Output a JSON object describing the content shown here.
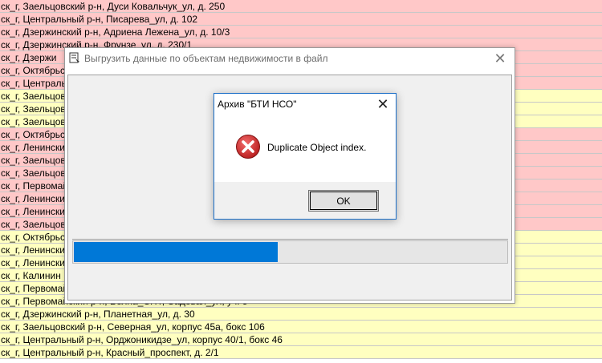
{
  "background_rows": [
    {
      "text": "ск_г, Заельцовский р-н, Дуси Ковальчук_ул, д. 250",
      "color": "pink"
    },
    {
      "text": "ск_г, Центральный р-н, Писарева_ул, д. 102",
      "color": "pink"
    },
    {
      "text": "ск_г, Дзержинский р-н, Адриена Лежена_ул, д. 10/3",
      "color": "pink"
    },
    {
      "text": "ск_г, Дзержинский р-н, Фрунзе_ул, д. 230/1",
      "color": "pink"
    },
    {
      "text": "ск_г, Дзержи",
      "color": "pink"
    },
    {
      "text": "ск_г, Октябрьс",
      "color": "pink"
    },
    {
      "text": "ск_г, Централь",
      "color": "pink"
    },
    {
      "text": "ск_г, Заельцов",
      "color": "yellow"
    },
    {
      "text": "ск_г, Заельцов",
      "color": "yellow"
    },
    {
      "text": "ск_г, Заельцов",
      "color": "yellow"
    },
    {
      "text": "ск_г, Октябрьс",
      "color": "pink"
    },
    {
      "text": "ск_г, Ленински",
      "color": "pink"
    },
    {
      "text": "ск_г, Заельцов",
      "color": "pink"
    },
    {
      "text": "ск_г, Заельцов",
      "color": "pink"
    },
    {
      "text": "ск_г, Первомай",
      "color": "pink"
    },
    {
      "text": "ск_г, Ленински",
      "color": "pink"
    },
    {
      "text": "ск_г, Ленински",
      "color": "pink"
    },
    {
      "text": "ск_г, Заельцов",
      "color": "pink"
    },
    {
      "text": "ск_г, Октябрьс",
      "color": "yellow"
    },
    {
      "text": "ск_г, Ленински",
      "color": "yellow"
    },
    {
      "text": "ск_г, Ленински",
      "color": "yellow"
    },
    {
      "text": "ск_г, Калинин",
      "color": "yellow"
    },
    {
      "text": "ск_г, Первомай",
      "color": "yellow"
    },
    {
      "text": "ск_г, Первомайский р-н, Волна_СНТ, Садовая_ул, уч. 5",
      "color": "yellow"
    },
    {
      "text": "ск_г, Дзержинский р-н, Планетная_ул, д. 30",
      "color": "yellow"
    },
    {
      "text": "ск_г, Заельцовский р-н, Северная_ул, корпус 45а, бокс 106",
      "color": "yellow"
    },
    {
      "text": "ск_г, Центральный р-н, Орджоникидзе_ул, корпус 40/1, бокс 46",
      "color": "yellow"
    },
    {
      "text": "ск_г, Центральный р-н, Красный_проспект, д. 2/1",
      "color": "yellow"
    }
  ],
  "outer_dialog": {
    "title": "Выгрузить данные по объектам недвижимости в файл",
    "close_glyph": "✕",
    "progress_fraction": 0.47
  },
  "modal": {
    "title": "Архив \"БТИ НСО\"",
    "close_glyph": "✕",
    "message": "Duplicate Object index.",
    "ok_label": "OK"
  },
  "colors": {
    "row_pink": "#ffc8c8",
    "row_yellow": "#ffffc0",
    "progress": "#0078d7",
    "error_red": "#d32f2f"
  },
  "icons": {
    "outer_title_icon": "app-icon",
    "modal_status_icon": "error-icon"
  }
}
